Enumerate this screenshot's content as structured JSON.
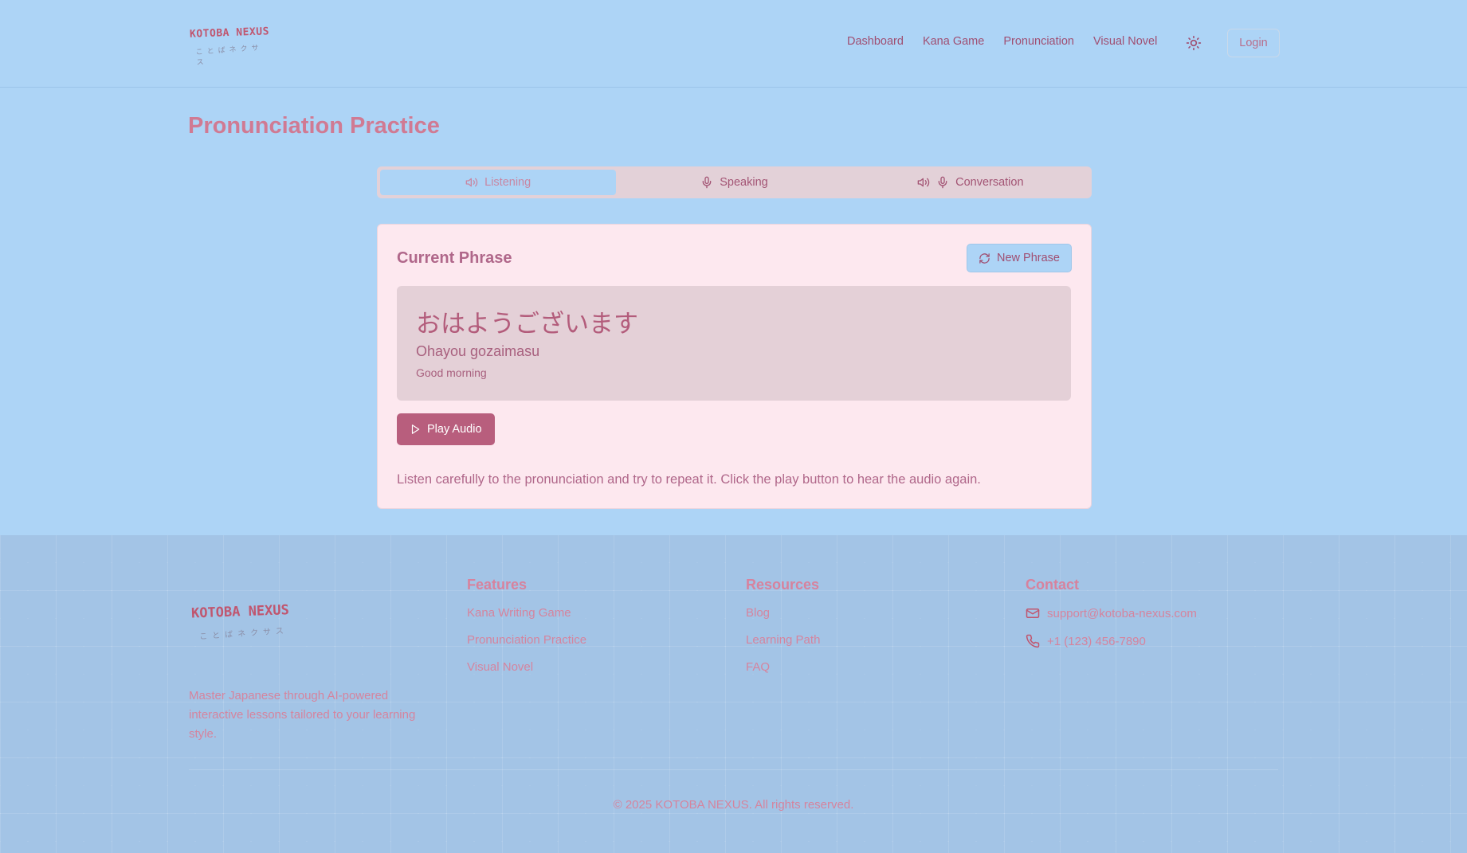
{
  "header": {
    "logo_text": "KOTOBA NEXUS",
    "logo_sub": "ことばネクサス",
    "nav": [
      "Dashboard",
      "Kana Game",
      "Pronunciation",
      "Visual Novel"
    ],
    "theme_icon": "sun-icon",
    "login_label": "Login"
  },
  "main": {
    "title": "Pronunciation Practice",
    "tabs": [
      {
        "label": "Listening",
        "icon": "speaker-icon"
      },
      {
        "label": "Speaking",
        "icon": "mic-icon"
      },
      {
        "label": "Conversation",
        "icon": "speaker-mic-icon"
      }
    ],
    "active_tab": "Listening",
    "card": {
      "title": "Current Phrase",
      "new_phrase_label": "New Phrase",
      "phrase_japanese": "おはようございます",
      "phrase_romaji": "Ohayou gozaimasu",
      "phrase_meaning": "Good morning",
      "play_label": "Play Audio",
      "instructions": "Listen carefully to the pronunciation and try to repeat it. Click the play button to hear the audio again."
    }
  },
  "footer": {
    "logo_text": "KOTOBA NEXUS",
    "logo_sub": "ことばネクサス",
    "description": "Master Japanese through AI-powered interactive lessons tailored to your learning style.",
    "features": {
      "heading": "Features",
      "links": [
        "Kana Writing Game",
        "Pronunciation Practice",
        "Visual Novel"
      ]
    },
    "resources": {
      "heading": "Resources",
      "links": [
        "Blog",
        "Learning Path",
        "FAQ"
      ]
    },
    "contact": {
      "heading": "Contact",
      "email": "support@kotoba-nexus.com",
      "phone": "+1 (123) 456-7890"
    },
    "copyright": "© 2025 KOTOBA NEXUS. All rights reserved."
  },
  "colors": {
    "background": "#add4f6",
    "accent": "#b85e7d",
    "card": "#fde8ef",
    "footer": "#a3c4e6"
  }
}
